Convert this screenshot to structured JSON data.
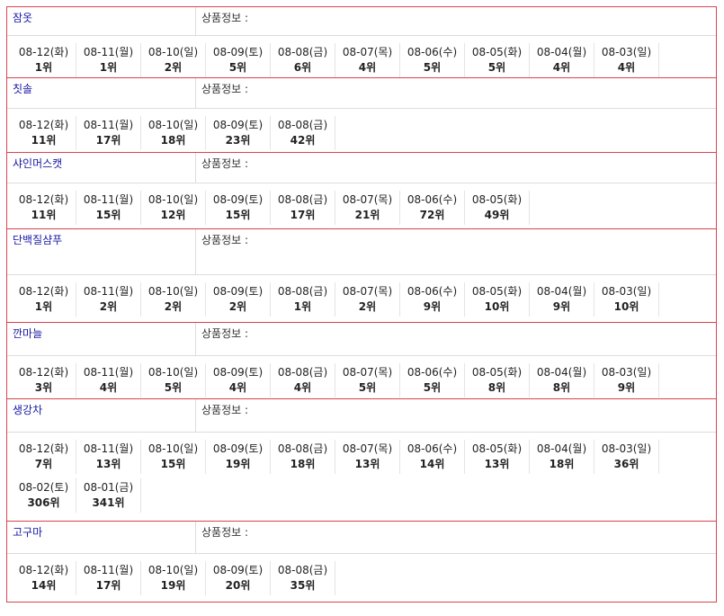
{
  "info_label": "상품정보 :",
  "keywords": [
    {
      "name": "잠옷",
      "head_h": 31,
      "rank_h": 46,
      "ranks": [
        {
          "date": "08-12(화)",
          "rank": "1위"
        },
        {
          "date": "08-11(월)",
          "rank": "1위"
        },
        {
          "date": "08-10(일)",
          "rank": "2위"
        },
        {
          "date": "08-09(토)",
          "rank": "5위"
        },
        {
          "date": "08-08(금)",
          "rank": "6위"
        },
        {
          "date": "08-07(목)",
          "rank": "4위"
        },
        {
          "date": "08-06(수)",
          "rank": "5위"
        },
        {
          "date": "08-05(화)",
          "rank": "5위"
        },
        {
          "date": "08-04(월)",
          "rank": "4위"
        },
        {
          "date": "08-03(일)",
          "rank": "4위"
        }
      ]
    },
    {
      "name": "칫솔",
      "head_h": 33,
      "rank_h": 48,
      "ranks": [
        {
          "date": "08-12(화)",
          "rank": "11위"
        },
        {
          "date": "08-11(월)",
          "rank": "17위"
        },
        {
          "date": "08-10(일)",
          "rank": "18위"
        },
        {
          "date": "08-09(토)",
          "rank": "23위"
        },
        {
          "date": "08-08(금)",
          "rank": "42위"
        }
      ]
    },
    {
      "name": "샤인머스캣",
      "head_h": 33,
      "rank_h": 50,
      "ranks": [
        {
          "date": "08-12(화)",
          "rank": "11위"
        },
        {
          "date": "08-11(월)",
          "rank": "15위"
        },
        {
          "date": "08-10(일)",
          "rank": "12위"
        },
        {
          "date": "08-09(토)",
          "rank": "15위"
        },
        {
          "date": "08-08(금)",
          "rank": "17위"
        },
        {
          "date": "08-07(목)",
          "rank": "21위"
        },
        {
          "date": "08-06(수)",
          "rank": "72위"
        },
        {
          "date": "08-05(화)",
          "rank": "49위"
        }
      ]
    },
    {
      "name": "단백질샴푸",
      "head_h": 50,
      "rank_h": 52,
      "ranks": [
        {
          "date": "08-12(화)",
          "rank": "1위"
        },
        {
          "date": "08-11(월)",
          "rank": "2위"
        },
        {
          "date": "08-10(일)",
          "rank": "2위"
        },
        {
          "date": "08-09(토)",
          "rank": "2위"
        },
        {
          "date": "08-08(금)",
          "rank": "1위"
        },
        {
          "date": "08-07(목)",
          "rank": "2위"
        },
        {
          "date": "08-06(수)",
          "rank": "9위"
        },
        {
          "date": "08-05(화)",
          "rank": "10위"
        },
        {
          "date": "08-04(월)",
          "rank": "9위"
        },
        {
          "date": "08-03(일)",
          "rank": "10위"
        }
      ]
    },
    {
      "name": "깐마늘",
      "head_h": 36,
      "rank_h": 47,
      "ranks": [
        {
          "date": "08-12(화)",
          "rank": "3위"
        },
        {
          "date": "08-11(월)",
          "rank": "4위"
        },
        {
          "date": "08-10(일)",
          "rank": "5위"
        },
        {
          "date": "08-09(토)",
          "rank": "4위"
        },
        {
          "date": "08-08(금)",
          "rank": "4위"
        },
        {
          "date": "08-07(목)",
          "rank": "5위"
        },
        {
          "date": "08-06(수)",
          "rank": "5위"
        },
        {
          "date": "08-05(화)",
          "rank": "8위"
        },
        {
          "date": "08-04(월)",
          "rank": "8위"
        },
        {
          "date": "08-03(일)",
          "rank": "9위"
        }
      ]
    },
    {
      "name": "생강차",
      "head_h": 36,
      "rank_h": 98,
      "ranks": [
        {
          "date": "08-12(화)",
          "rank": "7위"
        },
        {
          "date": "08-11(월)",
          "rank": "13위"
        },
        {
          "date": "08-10(일)",
          "rank": "15위"
        },
        {
          "date": "08-09(토)",
          "rank": "19위"
        },
        {
          "date": "08-08(금)",
          "rank": "18위"
        },
        {
          "date": "08-07(목)",
          "rank": "13위"
        },
        {
          "date": "08-06(수)",
          "rank": "14위"
        },
        {
          "date": "08-05(화)",
          "rank": "13위"
        },
        {
          "date": "08-04(월)",
          "rank": "18위"
        },
        {
          "date": "08-03(일)",
          "rank": "36위"
        },
        {
          "date": "08-02(토)",
          "rank": "306위"
        },
        {
          "date": "08-01(금)",
          "rank": "341위"
        }
      ]
    },
    {
      "name": "고구마",
      "head_h": 35,
      "rank_h": 53,
      "ranks": [
        {
          "date": "08-12(화)",
          "rank": "14위"
        },
        {
          "date": "08-11(월)",
          "rank": "17위"
        },
        {
          "date": "08-10(일)",
          "rank": "19위"
        },
        {
          "date": "08-09(토)",
          "rank": "20위"
        },
        {
          "date": "08-08(금)",
          "rank": "35위"
        }
      ]
    }
  ]
}
